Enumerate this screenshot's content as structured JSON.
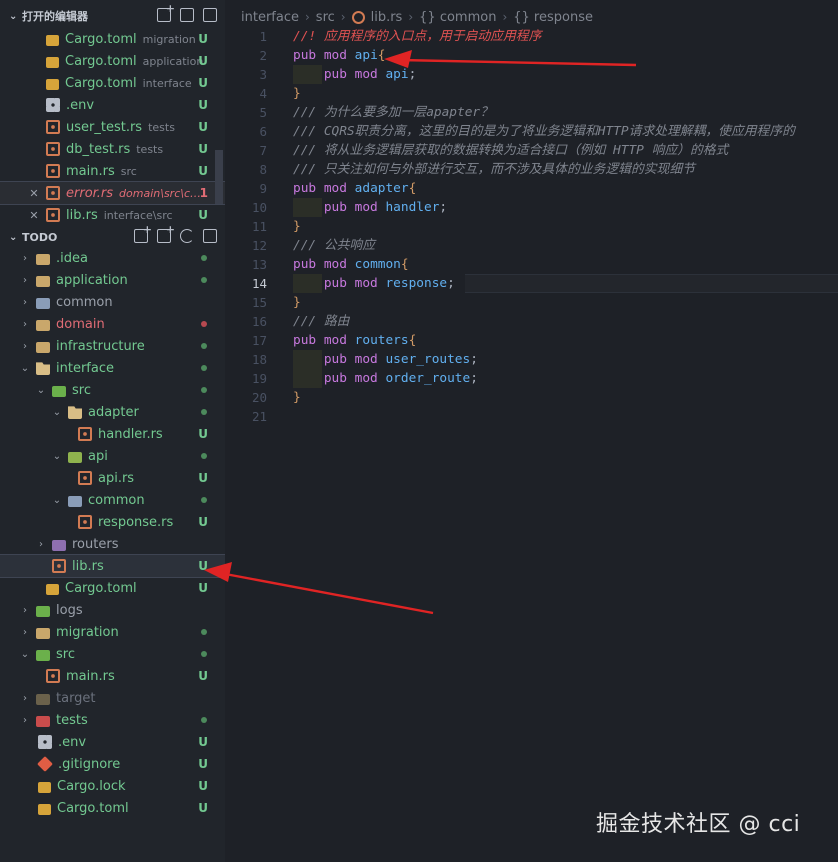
{
  "sidebar": {
    "open_editors_title": "打开的编辑器",
    "open_editors": [
      {
        "name": "Cargo.toml",
        "desc": "migration",
        "status": "U",
        "icon": "lock-icon"
      },
      {
        "name": "Cargo.toml",
        "desc": "application",
        "status": "U",
        "icon": "lock-icon"
      },
      {
        "name": "Cargo.toml",
        "desc": "interface",
        "status": "U",
        "icon": "lock-icon"
      },
      {
        "name": ".env",
        "desc": "",
        "status": "U",
        "icon": "gear-icon"
      },
      {
        "name": "user_test.rs",
        "desc": "tests",
        "status": "U",
        "icon": "rust-icon"
      },
      {
        "name": "db_test.rs",
        "desc": "tests",
        "status": "U",
        "icon": "rust-icon"
      },
      {
        "name": "main.rs",
        "desc": "src",
        "status": "U",
        "icon": "rust-icon"
      },
      {
        "name": "error.rs",
        "desc": "domain\\src\\co...",
        "status": "1",
        "icon": "rust-icon"
      },
      {
        "name": "lib.rs",
        "desc": "interface\\src",
        "status": "U",
        "icon": "rust-icon"
      }
    ],
    "todo_title": "TODO",
    "tree": [
      {
        "name": ".idea",
        "status": "dot"
      },
      {
        "name": "application",
        "status": "dot"
      },
      {
        "name": "common",
        "status": ""
      },
      {
        "name": "domain",
        "status": "dot-err"
      },
      {
        "name": "infrastructure",
        "status": "dot"
      },
      {
        "name": "interface",
        "status": "dot"
      },
      {
        "name": "src",
        "status": "dot"
      },
      {
        "name": "adapter",
        "status": "dot"
      },
      {
        "name": "handler.rs",
        "status": "U"
      },
      {
        "name": "api",
        "status": "dot"
      },
      {
        "name": "api.rs",
        "status": "U"
      },
      {
        "name": "common",
        "status": "dot"
      },
      {
        "name": "response.rs",
        "status": "U"
      },
      {
        "name": "routers",
        "status": ""
      },
      {
        "name": "lib.rs",
        "status": "U"
      },
      {
        "name": "Cargo.toml",
        "status": "U"
      },
      {
        "name": "logs",
        "status": ""
      },
      {
        "name": "migration",
        "status": "dot"
      },
      {
        "name": "src",
        "status": "dot"
      },
      {
        "name": "main.rs",
        "status": "U"
      },
      {
        "name": "target",
        "status": ""
      },
      {
        "name": "tests",
        "status": "dot"
      },
      {
        "name": ".env",
        "status": "U"
      },
      {
        "name": ".gitignore",
        "status": "U"
      },
      {
        "name": "Cargo.lock",
        "status": "U"
      },
      {
        "name": "Cargo.toml",
        "status": "U"
      }
    ]
  },
  "breadcrumb": [
    "interface",
    "src",
    "lib.rs",
    "{} common",
    "{} response"
  ],
  "editor": {
    "active_line": 14,
    "lines": [
      {
        "n": "1",
        "tokens": [
          [
            "cm-red",
            "//! 应用程序的入口点，用于启动应用程序"
          ]
        ]
      },
      {
        "n": "2",
        "tokens": [
          [
            "kw",
            "pub "
          ],
          [
            "kw",
            "mod "
          ],
          [
            "fn",
            "api"
          ],
          [
            "pun",
            "{"
          ]
        ]
      },
      {
        "n": "3",
        "tokens": [
          [
            "kw",
            "    pub "
          ],
          [
            "kw",
            "mod "
          ],
          [
            "fn",
            "api"
          ],
          [
            "pl",
            ";"
          ]
        ]
      },
      {
        "n": "4",
        "tokens": [
          [
            "pun",
            "}"
          ]
        ]
      },
      {
        "n": "5",
        "tokens": [
          [
            "cm",
            "/// 为什么要多加一层apapter？"
          ]
        ]
      },
      {
        "n": "6",
        "tokens": [
          [
            "cm",
            "/// CQRS职责分离，这里的目的是为了将业务逻辑和HTTP请求处理解耦，使应用程序的"
          ]
        ]
      },
      {
        "n": "7",
        "tokens": [
          [
            "cm",
            "/// 将从业务逻辑层获取的数据转换为适合接口（例如 HTTP 响应）的格式"
          ]
        ]
      },
      {
        "n": "8",
        "tokens": [
          [
            "cm",
            "/// 只关注如何与外部进行交互，而不涉及具体的业务逻辑的实现细节"
          ]
        ]
      },
      {
        "n": "9",
        "tokens": [
          [
            "kw",
            "pub "
          ],
          [
            "kw",
            "mod "
          ],
          [
            "fn",
            "adapter"
          ],
          [
            "pun",
            "{"
          ]
        ]
      },
      {
        "n": "10",
        "tokens": [
          [
            "kw",
            "    pub "
          ],
          [
            "kw",
            "mod "
          ],
          [
            "fn",
            "handler"
          ],
          [
            "pl",
            ";"
          ]
        ]
      },
      {
        "n": "11",
        "tokens": [
          [
            "pun",
            "}"
          ]
        ]
      },
      {
        "n": "12",
        "tokens": [
          [
            "cm",
            "/// 公共响应"
          ]
        ]
      },
      {
        "n": "13",
        "tokens": [
          [
            "kw",
            "pub "
          ],
          [
            "kw",
            "mod "
          ],
          [
            "fn",
            "common"
          ],
          [
            "pun",
            "{"
          ]
        ]
      },
      {
        "n": "14",
        "tokens": [
          [
            "kw",
            "    pub "
          ],
          [
            "kw",
            "mod "
          ],
          [
            "fn",
            "response"
          ],
          [
            "pl",
            ";"
          ]
        ]
      },
      {
        "n": "15",
        "tokens": [
          [
            "pun",
            "}"
          ]
        ]
      },
      {
        "n": "16",
        "tokens": [
          [
            "cm",
            "/// 路由"
          ]
        ]
      },
      {
        "n": "17",
        "tokens": [
          [
            "kw",
            "pub "
          ],
          [
            "kw",
            "mod "
          ],
          [
            "fn",
            "routers"
          ],
          [
            "pun",
            "{"
          ]
        ]
      },
      {
        "n": "18",
        "tokens": [
          [
            "kw",
            "    pub "
          ],
          [
            "kw",
            "mod "
          ],
          [
            "fn",
            "user_routes"
          ],
          [
            "pl",
            ";"
          ]
        ]
      },
      {
        "n": "19",
        "tokens": [
          [
            "kw",
            "    pub "
          ],
          [
            "kw",
            "mod "
          ],
          [
            "fn",
            "order_route"
          ],
          [
            "pl",
            ";"
          ]
        ]
      },
      {
        "n": "20",
        "tokens": [
          [
            "pun",
            "}"
          ]
        ]
      },
      {
        "n": "21",
        "tokens": []
      }
    ]
  },
  "watermark": "掘金技术社区 @ cci",
  "colors": {
    "arrow": "#e02424",
    "accent_green": "#73c991",
    "accent_red": "#e06c75"
  }
}
